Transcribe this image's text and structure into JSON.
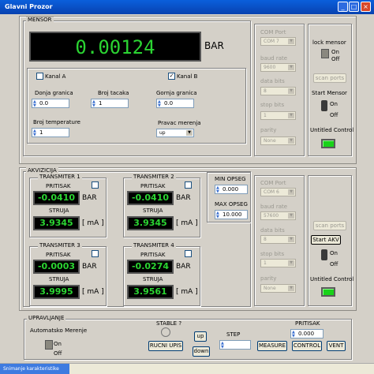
{
  "window": {
    "title": "Glavni Prozor",
    "min": "_",
    "max": "□",
    "close": "×"
  },
  "mensor": {
    "group_label": "MENSOR",
    "display_value": "0.00124",
    "unit": "BAR",
    "kanal_a": "Kanal A",
    "kanal_b": "Kanal B",
    "kanal_a_checked": "",
    "kanal_b_checked": "✓",
    "donja_label": "Donja granica",
    "donja_value": "0.0",
    "broj_tacaka_label": "Broj tacaka",
    "broj_tacaka_value": "1",
    "gornja_label": "Gornja granica",
    "gornja_value": "0.0",
    "broj_temp_label": "Broj temperature",
    "broj_temp_value": "1",
    "pravac_label": "Pravac merenja",
    "pravac_value": "up"
  },
  "com1": {
    "port_label": "COM Port",
    "port_value": "COM 7",
    "baud_label": "baud rate",
    "baud_value": "9600",
    "data_label": "data bits",
    "data_value": "8",
    "stop_label": "stop bits",
    "stop_value": "1",
    "parity_label": "parity",
    "parity_value": "None"
  },
  "right1": {
    "lock_label": "lock mensor",
    "on": "On",
    "off": "Off",
    "scan_label": "scan ports",
    "start_label": "Start Mensor",
    "untitled_label": "Untitled Control"
  },
  "akvizicija": {
    "group_label": "AKVIZICIJA",
    "pritisak": "PRITISAK",
    "struja": "STRUJA",
    "bar": "BAR",
    "ma": "[ mA ]",
    "transmitters": [
      {
        "name": "TRANSMITER 1",
        "pressure": "-0.0410",
        "current": "3.9345"
      },
      {
        "name": "TRANSMITER 2",
        "pressure": "-0.0410",
        "current": "3.9345"
      },
      {
        "name": "TRANSMITER 3",
        "pressure": "-0.0003",
        "current": "3.9995"
      },
      {
        "name": "TRANSMITER 4",
        "pressure": "-0.0274",
        "current": "3.9561"
      }
    ],
    "min_label": "MIN OPSEG",
    "min_value": "0.000",
    "max_label": "MAX OPSEG",
    "max_value": "10.000"
  },
  "com2": {
    "port_label": "COM Port",
    "port_value": "COM 6",
    "baud_label": "baud rate",
    "baud_value": "57600",
    "data_label": "data bits",
    "data_value": "8",
    "stop_label": "stop bits",
    "stop_value": "1",
    "parity_label": "parity",
    "parity_value": "None"
  },
  "right2": {
    "scan_label": "scan ports",
    "start_label": "Start AKV",
    "on": "On",
    "off": "Off",
    "untitled_label": "Untitled Control"
  },
  "upravljanje": {
    "group_label": "UPRAVLJANJE",
    "auto_label": "Automatsko Merenje",
    "on": "On",
    "off": "Off",
    "stable_label": "STABLE ?",
    "rucni_label": "RUCNI UPIS",
    "up_label": "up",
    "down_label": "down",
    "step_label": "STEP",
    "step_value": "",
    "measure_label": "MEASURE",
    "pritisak_label": "PRITISAK",
    "pritisak_value": "0.000",
    "control_label": "CONTROL",
    "vent_label": "VENT"
  },
  "taskbar": {
    "item": "Snimanje karakteristike"
  }
}
